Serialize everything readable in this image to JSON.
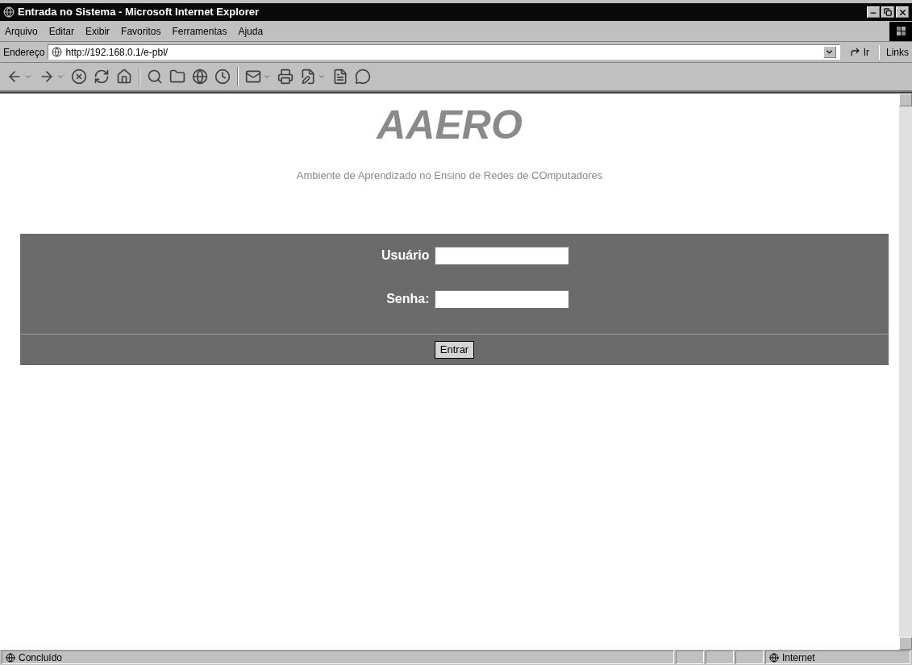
{
  "window": {
    "title": "Entrada no Sistema - Microsoft Internet Explorer"
  },
  "menu": [
    "Arquivo",
    "Editar",
    "Exibir",
    "Favoritos",
    "Ferramentas",
    "Ajuda"
  ],
  "address_bar": {
    "label": "Endereço",
    "value": "http://192.168.0.1/e-pbl/",
    "go": "Ir",
    "links": "Links"
  },
  "page": {
    "title": "AAERO",
    "subtitle": "Ambiente de Aprendizado no Ensino de Redes de COmputadores",
    "fields": [
      {
        "label": "Usuário"
      },
      {
        "label": "Senha:"
      }
    ],
    "button": "Entrar"
  },
  "status_bar": {
    "text": "Concluído",
    "zone": "Internet"
  }
}
